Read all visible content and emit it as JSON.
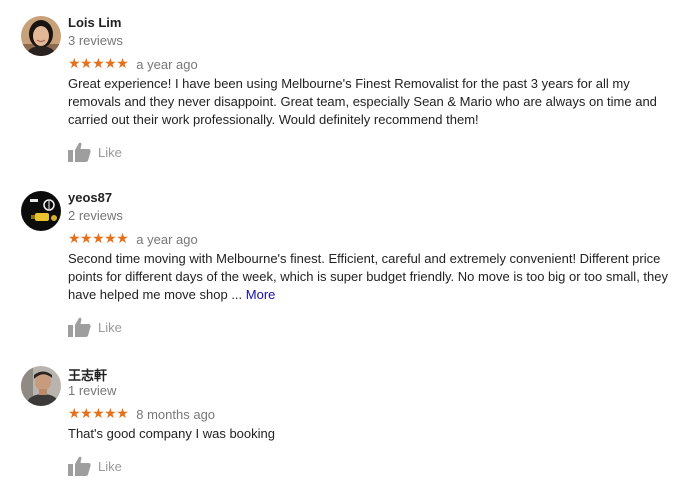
{
  "reviews": [
    {
      "author": "Lois Lim",
      "review_count": "3 reviews",
      "stars": "★★★★★",
      "date": "a year ago",
      "text": "Great experience! I have been  using Melbourne's Finest Removalist for the past 3 years for all my removals and they never disappoint. Great team, especially Sean & Mario who are always on time and carried out their work professionally. Would definitely recommend them!",
      "rating": 5,
      "like_label": "Like",
      "avatar_icon": "woman-portrait-avatar"
    },
    {
      "author": "yeos87",
      "review_count": "2 reviews",
      "stars": "★★★★★",
      "date": "a year ago",
      "text": "Second time moving with Melbourne's finest. Efficient, careful and extremely convenient! Different price points for different days of the week, which is super budget friendly. No move is too big or too small, they have helped me move shop ...",
      "more_label": "More",
      "rating": 5,
      "like_label": "Like",
      "avatar_icon": "dark-photo-avatar"
    },
    {
      "author": "王志軒",
      "review_count": "1 review",
      "stars": "★★★★★",
      "date": "8 months ago",
      "text": "That's good company I was booking",
      "rating": 5,
      "like_label": "Like",
      "avatar_icon": "man-portrait-avatar"
    }
  ],
  "colors": {
    "star": "#e7711b",
    "muted": "#777777",
    "link": "#1a0dab",
    "like_icon": "#9e9e9e"
  }
}
